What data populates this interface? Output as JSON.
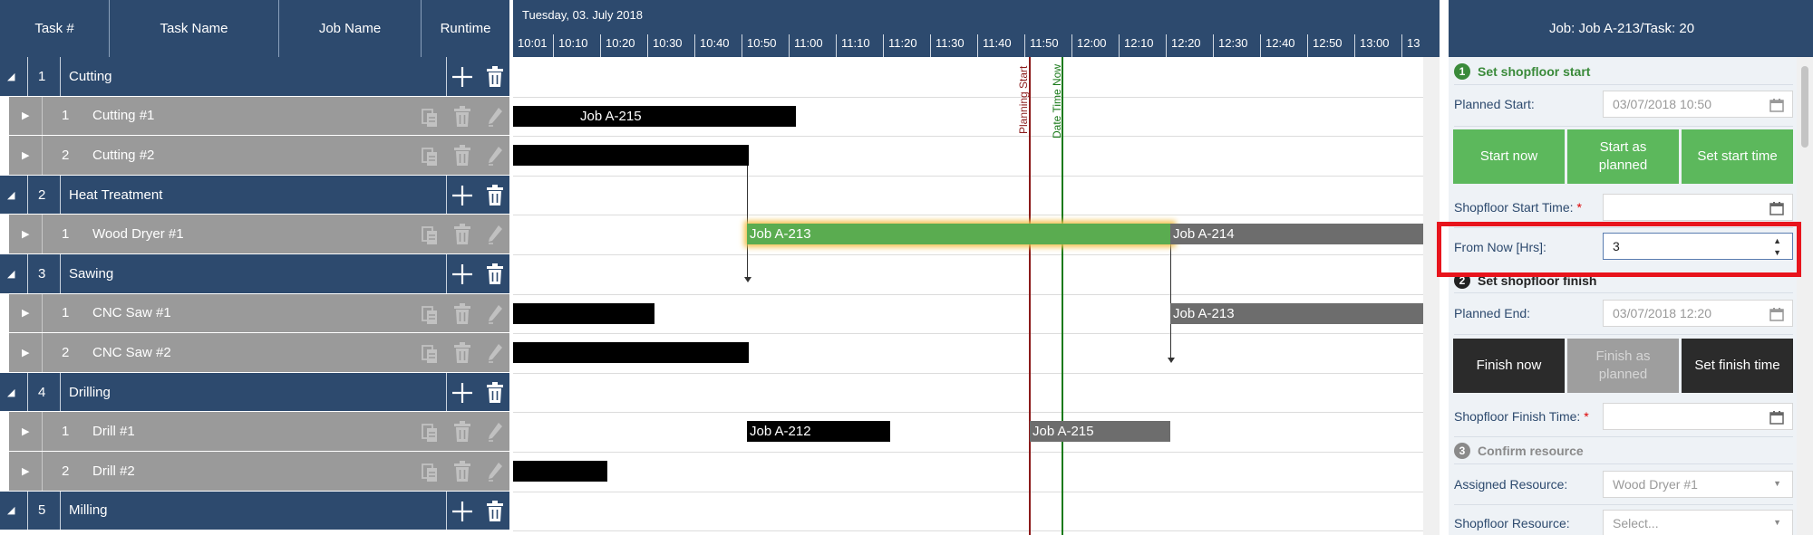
{
  "grid": {
    "headers": {
      "task_num": "Task #",
      "task_name": "Task Name",
      "job_name": "Job Name",
      "runtime": "Runtime"
    },
    "rows": [
      {
        "kind": "group",
        "num": "1",
        "name": "Cutting"
      },
      {
        "kind": "task",
        "num": "1",
        "name": "Cutting #1"
      },
      {
        "kind": "task",
        "num": "2",
        "name": "Cutting #2"
      },
      {
        "kind": "group",
        "num": "2",
        "name": "Heat Treatment"
      },
      {
        "kind": "task",
        "num": "1",
        "name": "Wood Dryer #1"
      },
      {
        "kind": "group",
        "num": "3",
        "name": "Sawing"
      },
      {
        "kind": "task",
        "num": "1",
        "name": "CNC Saw #1"
      },
      {
        "kind": "task",
        "num": "2",
        "name": "CNC Saw #2"
      },
      {
        "kind": "group",
        "num": "4",
        "name": "Drilling"
      },
      {
        "kind": "task",
        "num": "1",
        "name": "Drill #1"
      },
      {
        "kind": "task",
        "num": "2",
        "name": "Drill #2"
      },
      {
        "kind": "group",
        "num": "5",
        "name": "Milling"
      }
    ]
  },
  "gantt": {
    "date": "Tuesday, 03. July 2018",
    "ticks": [
      "10:01",
      "10:10",
      "10:20",
      "10:30",
      "10:40",
      "10:50",
      "11:00",
      "11:10",
      "11:20",
      "11:30",
      "11:40",
      "11:50",
      "12:00",
      "12:10",
      "12:20",
      "12:30",
      "12:40",
      "12:50",
      "13:00",
      "13"
    ],
    "planning_start_label": "Planning Start",
    "date_time_now_label": "Date Time Now",
    "bars": [
      {
        "row": 1,
        "label": "Job A-215",
        "style": "black"
      },
      {
        "row": 2,
        "label": "",
        "style": "black"
      },
      {
        "row": 4,
        "label": "Job A-213",
        "style": "green"
      },
      {
        "row": 4,
        "label": "Job A-214",
        "style": "gray"
      },
      {
        "row": 6,
        "label": "",
        "style": "black"
      },
      {
        "row": 6,
        "label": "Job A-213",
        "style": "gray"
      },
      {
        "row": 7,
        "label": "",
        "style": "black"
      },
      {
        "row": 9,
        "label": "Job A-212",
        "style": "black"
      },
      {
        "row": 9,
        "label": "Job A-215",
        "style": "gray"
      },
      {
        "row": 10,
        "label": "",
        "style": "black"
      }
    ]
  },
  "panel": {
    "title": "Job: Job A-213/Task: 20",
    "step1": {
      "num": "1",
      "title": "Set shopfloor start"
    },
    "planned_start": {
      "label": "Planned Start:",
      "value": "03/07/2018 10:50"
    },
    "start_buttons": {
      "start_now": "Start now",
      "start_as_planned": "Start as planned",
      "set_start_time": "Set start time"
    },
    "shopfloor_start_time": {
      "label": "Shopfloor Start Time:",
      "required": "*",
      "value": ""
    },
    "from_now": {
      "label": "From Now [Hrs]:",
      "value": "3"
    },
    "step2": {
      "num": "2",
      "title": "Set shopfloor finish"
    },
    "planned_end": {
      "label": "Planned End:",
      "value": "03/07/2018 12:20"
    },
    "finish_buttons": {
      "finish_now": "Finish now",
      "finish_as_planned": "Finish as planned",
      "set_finish_time": "Set finish time"
    },
    "shopfloor_finish_time": {
      "label": "Shopfloor Finish Time:",
      "required": "*",
      "value": ""
    },
    "step3": {
      "num": "3",
      "title": "Confirm resource"
    },
    "assigned_resource": {
      "label": "Assigned Resource:",
      "value": "Wood Dryer #1"
    },
    "shopfloor_resource": {
      "label": "Shopfloor Resource:",
      "placeholder": "Select..."
    }
  },
  "colors": {
    "header_bg": "#2d4a6e",
    "task_row_bg": "#9a9a9a",
    "accent_green": "#5cb85c",
    "highlight_red": "#e8141c",
    "planning_start_line": "#8b1a1a",
    "date_time_now_line": "#1a7a1a"
  }
}
